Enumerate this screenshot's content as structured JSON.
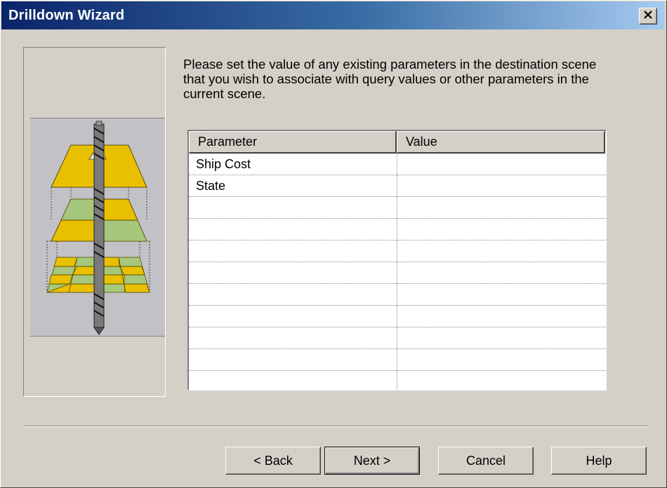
{
  "window": {
    "title": "Drilldown Wizard"
  },
  "instructions": "Please set the value of any existing parameters in the destination scene that you wish to associate with query values or other parameters in the current scene.",
  "table": {
    "columns": [
      "Parameter",
      "Value"
    ],
    "rows": [
      [
        "Ship Cost",
        ""
      ],
      [
        "State",
        ""
      ],
      [
        "",
        ""
      ],
      [
        "",
        ""
      ],
      [
        "",
        ""
      ],
      [
        "",
        ""
      ],
      [
        "",
        ""
      ],
      [
        "",
        ""
      ],
      [
        "",
        ""
      ],
      [
        "",
        ""
      ],
      [
        "",
        ""
      ]
    ]
  },
  "buttons": {
    "back": "< Back",
    "next": "Next >",
    "cancel": "Cancel",
    "help": "Help"
  },
  "icons": {
    "close": "close-icon",
    "wizard_graphic": "drilldown-layers-icon"
  },
  "colors": {
    "title_gradient_start": "#0a246a",
    "title_gradient_end": "#a6caf0",
    "dialog_face": "#d4d0c8",
    "layer_yellow": "#e8c000",
    "layer_green": "#a6c77c"
  }
}
